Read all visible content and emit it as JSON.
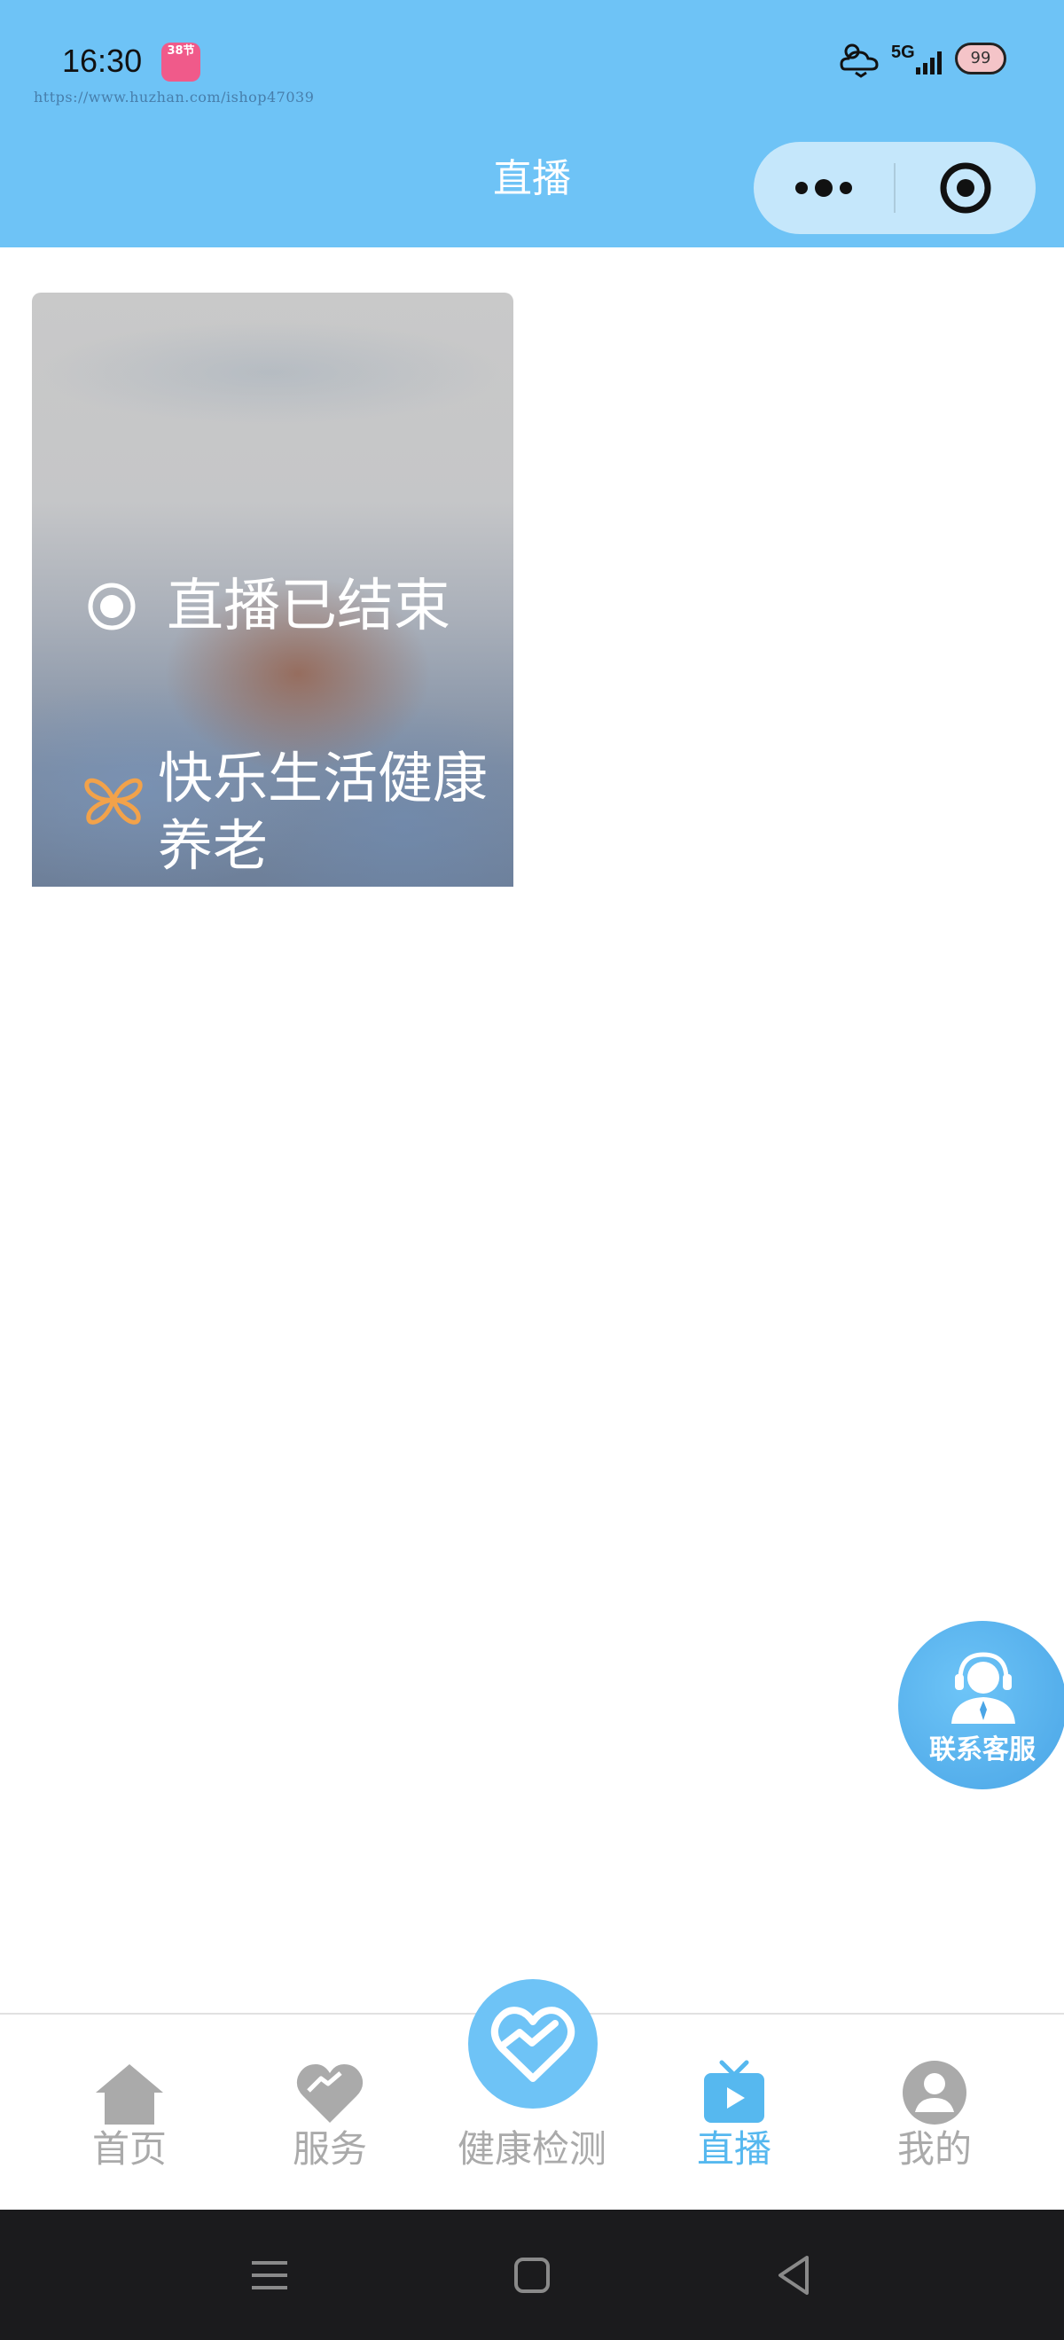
{
  "status_bar": {
    "time": "16:30",
    "app_badge": "38节",
    "url_watermark": "https://www.huzhan.com/ishop47039",
    "network": "5G",
    "battery": "99"
  },
  "nav_bar": {
    "title": "直播",
    "more_icon": "more-dots-icon",
    "close_icon": "target-close-icon"
  },
  "live_card": {
    "status": "直播已结束",
    "title": "快乐生活健康养老"
  },
  "service_fab": {
    "label": "联系客服"
  },
  "tabbar": {
    "active": "直播",
    "accent_color": "#56b8ef",
    "inactive_color": "#aaaaaa",
    "items": [
      {
        "label": "首页",
        "icon": "home-icon"
      },
      {
        "label": "服务",
        "icon": "heart-icon"
      },
      {
        "label": "健康检测",
        "icon": "heart-pulse-icon"
      },
      {
        "label": "直播",
        "icon": "tv-play-icon"
      },
      {
        "label": "我的",
        "icon": "user-icon"
      }
    ]
  },
  "system_nav": [
    "menu",
    "home",
    "back"
  ]
}
